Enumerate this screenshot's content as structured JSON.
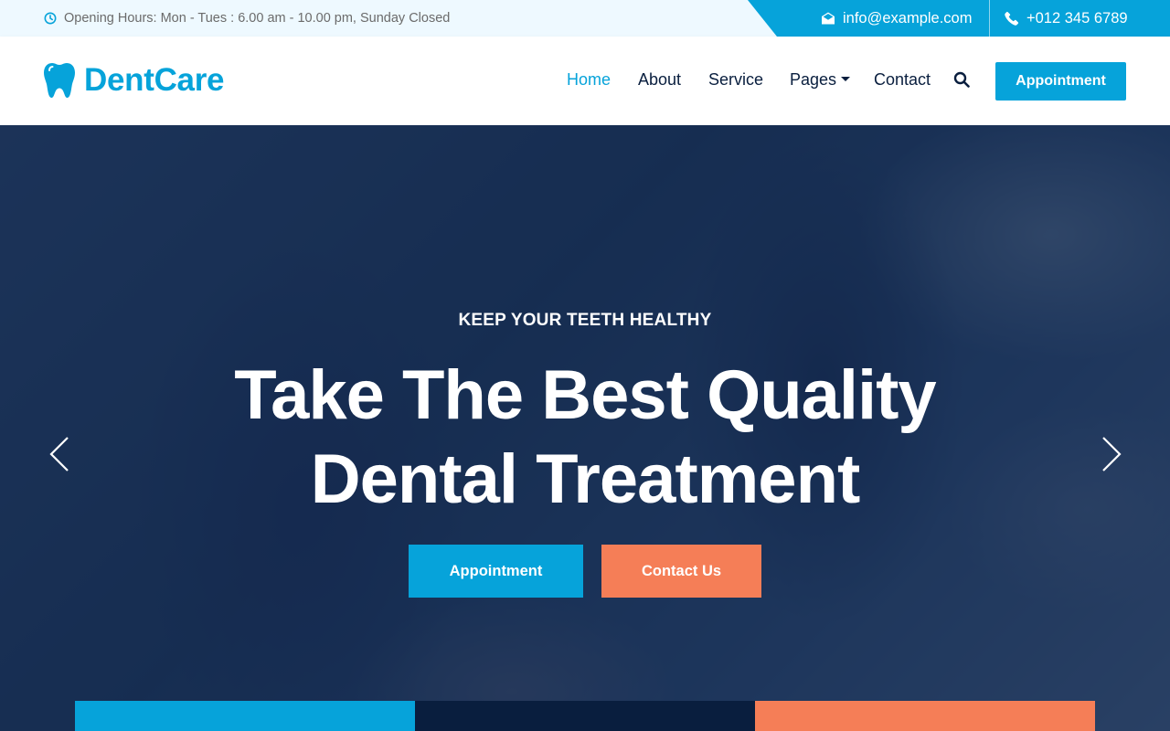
{
  "topbar": {
    "hours_text": "Opening Hours: Mon - Tues : 6.00 am - 10.00 pm, Sunday Closed",
    "email": "info@example.com",
    "phone": "+012 345 6789"
  },
  "navbar": {
    "brand": "DentCare",
    "links": [
      {
        "label": "Home",
        "active": true
      },
      {
        "label": "About",
        "active": false
      },
      {
        "label": "Service",
        "active": false
      },
      {
        "label": "Pages",
        "active": false,
        "dropdown": true
      },
      {
        "label": "Contact",
        "active": false
      }
    ],
    "appointment_label": "Appointment"
  },
  "hero": {
    "subtitle": "KEEP YOUR TEETH HEALTHY",
    "title_line1": "Take The Best Quality",
    "title_line2": "Dental Treatment",
    "primary_button": "Appointment",
    "secondary_button": "Contact Us"
  },
  "colors": {
    "primary": "#06a3da",
    "dark": "#091e3e",
    "secondary": "#f57e57",
    "topbar_bg": "#eef9ff"
  },
  "icons": {
    "hours": "clock-icon",
    "email": "envelope-open-icon",
    "phone": "phone-icon",
    "brand": "tooth-icon",
    "search": "search-icon",
    "prev": "chevron-left-icon",
    "next": "chevron-right-icon"
  }
}
